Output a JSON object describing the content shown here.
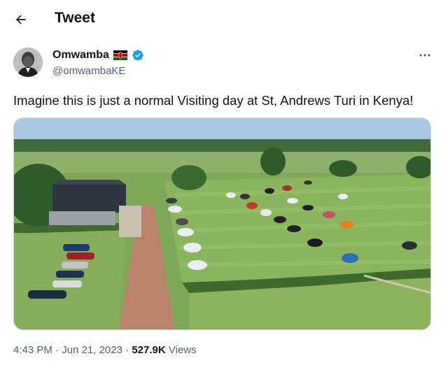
{
  "header": {
    "title": "Tweet",
    "back_icon": "arrow-left-icon"
  },
  "author": {
    "display_name": "Omwamba",
    "handle": "@omwambaKE",
    "flag_icon": "kenya-flag-icon",
    "verified_icon": "verified-badge-icon"
  },
  "tweet": {
    "text": "Imagine this is just a normal Visiting day at St, Andrews Turi in Kenya!",
    "more_icon": "more-options-icon"
  },
  "meta": {
    "time": "4:43 PM",
    "sep1": " · ",
    "date": "Jun 21, 2023",
    "sep2": " · ",
    "views_count": "527.9K",
    "views_label": " Views"
  },
  "colors": {
    "accent": "#1d9bf0",
    "secondary_text": "#536471"
  }
}
